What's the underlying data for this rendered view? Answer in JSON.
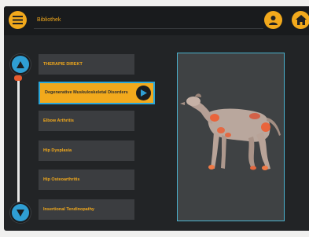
{
  "header": {
    "title": "Bibliothek",
    "icons": [
      "menu-icon",
      "user-icon",
      "home-icon"
    ]
  },
  "colors": {
    "accent": "#f2a91c",
    "background": "#222426",
    "item_bg": "#3b3d40",
    "selection_border": "#2aa6d9",
    "arrow": "#2f9ed3",
    "slider_thumb": "#e65b2e"
  },
  "list": {
    "items": [
      {
        "label": "THERAPIE DIREKT",
        "selected": false
      },
      {
        "label": "Degenerative Muskuloskeletal Disorders",
        "selected": true
      },
      {
        "label": "Elbow Arthritis",
        "selected": false
      },
      {
        "label": "Hip Dysplasia",
        "selected": false
      },
      {
        "label": "Hip Osteoarthritis",
        "selected": false
      },
      {
        "label": "Insertional Tendinopathy",
        "selected": false
      }
    ]
  },
  "scroll": {
    "position": 0.0
  }
}
